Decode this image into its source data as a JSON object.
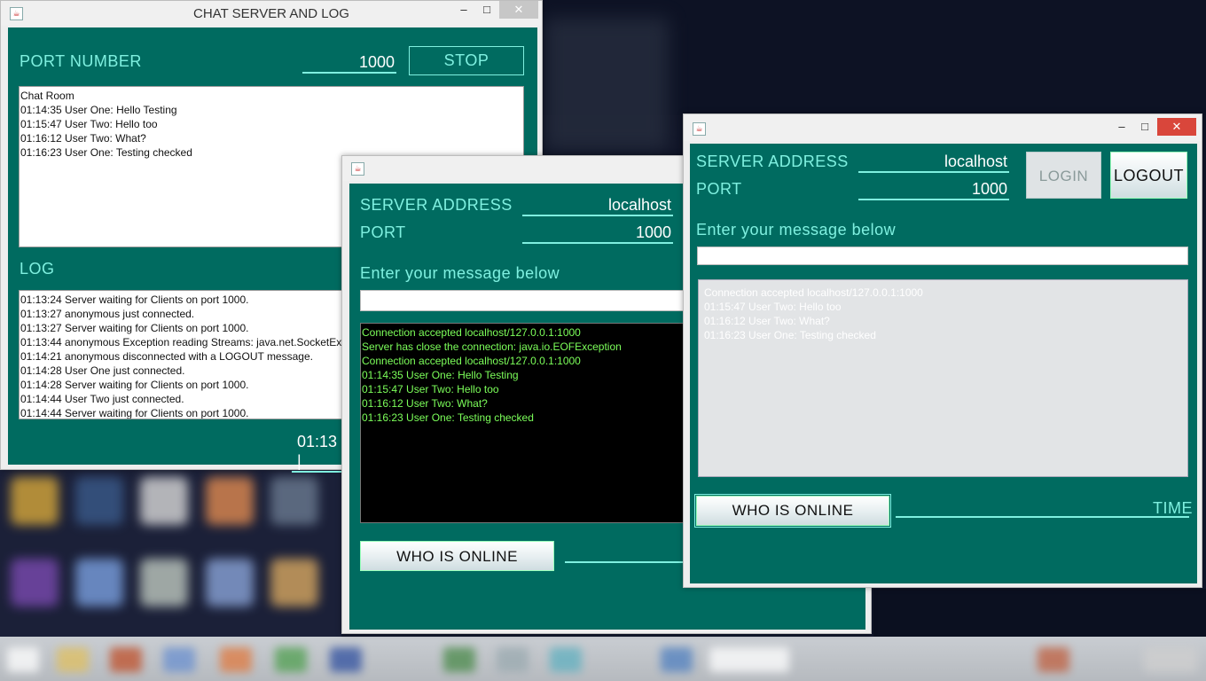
{
  "server_window": {
    "title": "CHAT SERVER AND LOG",
    "port_label": "PORT NUMBER",
    "port_value": "1000",
    "stop_label": "STOP",
    "chat_lines": [
      "Chat Room",
      "01:14:35 User One: Hello Testing",
      "01:15:47 User Two: Hello too",
      "01:16:12 User Two: What?",
      "01:16:23 User One: Testing checked"
    ],
    "log_label": "LOG",
    "log_lines": [
      "01:13:24 Server waiting for Clients on port 1000.",
      "01:13:27 anonymous just connected.",
      "01:13:27 Server waiting for Clients on port 1000.",
      "01:13:44 anonymous Exception reading Streams: java.net.SocketEx",
      "01:14:21 anonymous disconnected with a LOGOUT message.",
      "01:14:28 User One just connected.",
      "01:14:28 Server waiting for Clients on port 1000.",
      "01:14:44 User Two just connected.",
      "01:14:44 Server waiting for Clients on port 1000."
    ],
    "time_value": "01:13 |"
  },
  "client_one": {
    "server_address_label": "SERVER ADDRESS",
    "server_address_value": "localhost",
    "port_label": "PORT",
    "port_value": "1000",
    "message_prompt": "Enter your message below",
    "console_lines": [
      "Connection accepted localhost/127.0.0.1:1000",
      "Server has close the connection: java.io.EOFException",
      "Connection accepted localhost/127.0.0.1:1000",
      "01:14:35 User One: Hello Testing",
      "01:15:47 User Two: Hello too",
      "01:16:12 User Two: What?",
      "01:16:23 User One: Testing checked"
    ],
    "who_is_online_label": "WHO IS ONLINE"
  },
  "client_two": {
    "server_address_label": "SERVER ADDRESS",
    "server_address_value": "localhost",
    "port_label": "PORT",
    "port_value": "1000",
    "login_label": "LOGIN",
    "logout_label": "LOGOUT",
    "message_prompt": "Enter your message below",
    "chat_lines": [
      "Connection accepted localhost/127.0.0.1:1000",
      "01:15:47 User Two: Hello too",
      "01:16:12 User Two: What?",
      "01:16:23 User One: Testing checked"
    ],
    "who_is_online_label": "WHO IS ONLINE",
    "time_label": "TIME"
  },
  "window_controls": {
    "minimize": "–",
    "maximize": "□",
    "close": "✕",
    "app_icon": "java-icon"
  },
  "colors": {
    "panel": "#006b60",
    "accent": "#7ff0e0",
    "console_text": "#7cff5a"
  }
}
